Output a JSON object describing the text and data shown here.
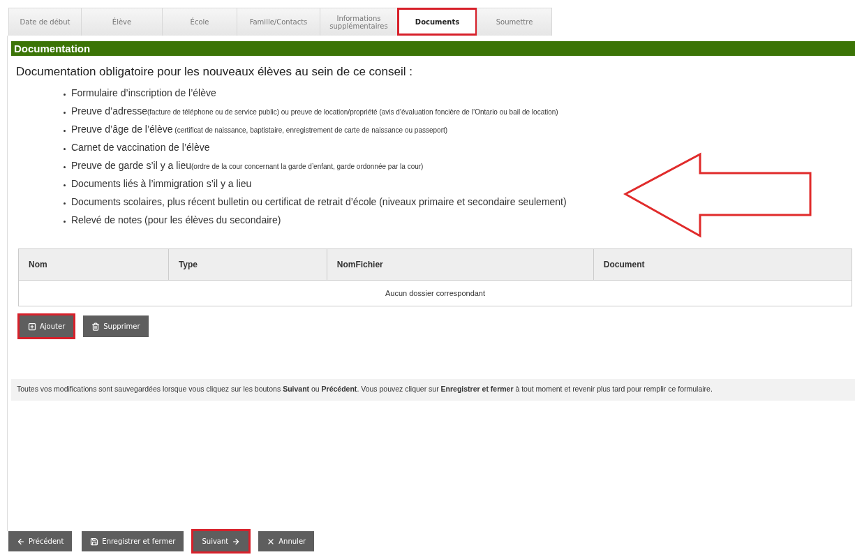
{
  "tabs": [
    {
      "label": "Date de début",
      "selected": false,
      "highlighted": false
    },
    {
      "label": "Élève",
      "selected": false,
      "highlighted": false
    },
    {
      "label": "École",
      "selected": false,
      "highlighted": false
    },
    {
      "label": "Famille/Contacts",
      "selected": false,
      "highlighted": false
    },
    {
      "label": "Informations supplémentaires",
      "selected": false,
      "highlighted": false
    },
    {
      "label": "Documents",
      "selected": true,
      "highlighted": true
    },
    {
      "label": "Soumettre",
      "selected": false,
      "highlighted": false
    }
  ],
  "section": {
    "title": "Documentation",
    "heading": "Documentation obligatoire pour les nouveaux élèves au sein de ce conseil :",
    "items": [
      {
        "main": "Formulaire d’inscription de l’élève"
      },
      {
        "main": "Preuve d’adresse",
        "detail": "(facture de téléphone ou de service public) ou preuve de location/propriété (avis d’évaluation foncière de l’Ontario ou bail de location)"
      },
      {
        "main": "Preuve d’âge de l’élève",
        "detail": " (certificat de naissance, baptistaire, enregistrement de carte de naissance ou passeport)"
      },
      {
        "main": "Carnet de vaccination de l’élève"
      },
      {
        "main": "Preuve de garde s’il y a lieu",
        "detail": "(ordre de la cour concernant la garde d’enfant, garde ordonnée par la cour)"
      },
      {
        "main": "Documents liés à l’immigration s’il y a lieu"
      },
      {
        "main": "Documents scolaires, plus récent bulletin ou certificat de retrait d’école (niveaux primaire et secondaire seulement)"
      },
      {
        "main": "Relevé de notes (pour les élèves du secondaire)"
      }
    ]
  },
  "annotation": {
    "kind": "arrow"
  },
  "table": {
    "columns": [
      "Nom",
      "Type",
      "NomFichier",
      "Document"
    ],
    "empty_message": "Aucun dossier correspondant"
  },
  "table_buttons": [
    {
      "kind": "add",
      "label": "Ajouter",
      "highlighted": true
    },
    {
      "kind": "delete",
      "label": "Supprimer",
      "highlighted": false
    }
  ],
  "notice": "Toutes vos modifications sont sauvegardées lorsque vous cliquez sur les boutons **Suivant** ou **Précédent**. Vous pouvez cliquer sur **Enregistrer et fermer** à tout moment et revenir plus tard pour remplir ce formulaire.",
  "footer_buttons": [
    {
      "kind": "back",
      "label": "Précédent",
      "highlighted": false
    },
    {
      "kind": "save",
      "label": "Enregistrer et fermer",
      "highlighted": false
    },
    {
      "kind": "next",
      "label": "Suivant",
      "highlighted": true
    },
    {
      "kind": "cancel",
      "label": "Annuler",
      "highlighted": false
    }
  ]
}
